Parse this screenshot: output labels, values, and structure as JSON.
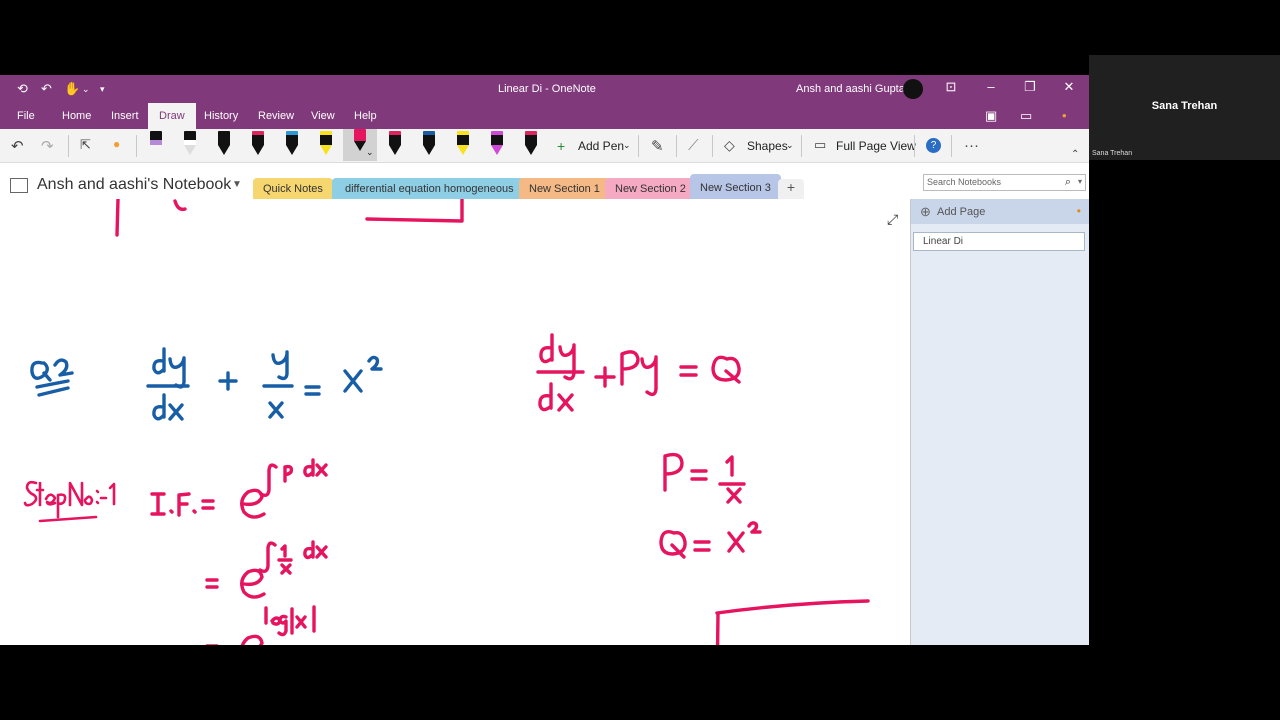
{
  "window": {
    "title": "Linear Di  -  OneNote",
    "user_name": "Ansh and aashi Gupta"
  },
  "ribbon": {
    "tabs": [
      "File",
      "Home",
      "Insert",
      "Draw",
      "History",
      "Review",
      "View",
      "Help"
    ],
    "active_tab": "Draw"
  },
  "toolbar": {
    "add_pen": "Add Pen",
    "shapes": "Shapes",
    "full_page_view": "Full Page View",
    "pens": [
      {
        "color": "#b48ad8",
        "icon": "pen-icon"
      },
      {
        "color": "#ffffff",
        "icon": "pen-icon"
      },
      {
        "color": "#111111",
        "icon": "pen-icon"
      },
      {
        "color": "#e0245e",
        "icon": "pen-icon"
      },
      {
        "color": "#2b9bd8",
        "icon": "pen-icon"
      },
      {
        "color": "#f7e21b",
        "icon": "highlighter-icon"
      },
      {
        "color": "#e6135f",
        "icon": "pen-icon"
      },
      {
        "color": "#e0245e",
        "icon": "pen-icon"
      },
      {
        "color": "#175ea6",
        "icon": "pen-icon"
      },
      {
        "color": "#f7e21b",
        "icon": "highlighter-icon"
      },
      {
        "color": "#f7e21b",
        "icon": "highlighter-icon"
      },
      {
        "color": "#d04ad8",
        "icon": "highlighter-icon"
      },
      {
        "color": "#e0245e",
        "icon": "highlighter-icon"
      }
    ]
  },
  "notebook": {
    "name": "Ansh and aashi's Notebook",
    "sections": [
      {
        "label": "Quick Notes",
        "color": "#f6d66f"
      },
      {
        "label": "differential equation homogeneous",
        "color": "#8ecfe6"
      },
      {
        "label": "New Section 1",
        "color": "#f4b984"
      },
      {
        "label": "New Section 2",
        "color": "#f5a9c3"
      },
      {
        "label": "New Section 3",
        "color": "#b7c6e6"
      }
    ],
    "active_section": "New Section 3",
    "search_placeholder": "Search Notebooks"
  },
  "pages": {
    "add_page": "Add Page",
    "items": [
      "Linear Di"
    ]
  },
  "video": {
    "participant": "Sana Trehan",
    "caption": "Sana Trehan"
  },
  "colors": {
    "onenote_purple": "#80397b",
    "ink_pink": "#e6135f",
    "ink_blue": "#175ea6"
  }
}
